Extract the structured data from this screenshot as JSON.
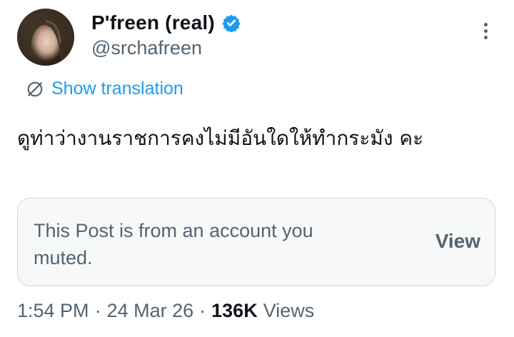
{
  "profile": {
    "display_name": "P'freen (real)",
    "handle": "@srchafreen",
    "verified_icon": "verified-badge-icon",
    "avatar": "avatar"
  },
  "post": {
    "translate_label": "Show translation",
    "text": "ดูท่าว่างานราชการคงไม่มีอันใดให้ทำกระมัง คะ"
  },
  "muted_notice": {
    "message": "This Post is from an account you muted.",
    "view_label": "View"
  },
  "meta": {
    "time": "1:54 PM",
    "separator1": "·",
    "date": "24 Mar 26",
    "separator2": "·",
    "views_count": "136K",
    "views_label": "Views"
  },
  "colors": {
    "accent": "#1d9bf0",
    "text_primary": "#0f1419",
    "text_secondary": "#536471",
    "box_bg": "#f7f9f9",
    "box_border": "#cfd9de"
  }
}
